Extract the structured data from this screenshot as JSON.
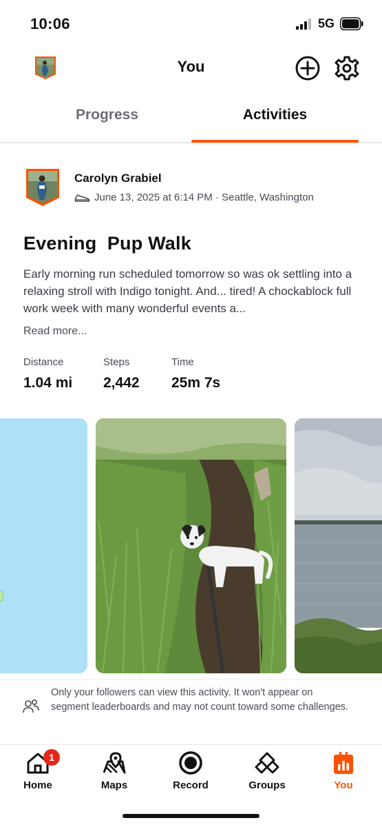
{
  "status_bar": {
    "time": "10:06",
    "network": "5G"
  },
  "header": {
    "title": "You"
  },
  "tabs": [
    {
      "label": "Progress",
      "active": false
    },
    {
      "label": "Activities",
      "active": true
    }
  ],
  "activity": {
    "athlete_name": "Carolyn Grabiel",
    "meta": "June 13, 2025 at 6:14 PM · Seattle, Washington",
    "title": "Evening  Pup Walk",
    "description": "Early morning run scheduled tomorrow so was ok settling into a relaxing stroll with Indigo tonight. And... tired! A chockablock full work week with many wonderful events a...",
    "read_more": "Read more...",
    "stats": [
      {
        "label": "Distance",
        "value": "1.04 mi"
      },
      {
        "label": "Steps",
        "value": "2,442"
      },
      {
        "label": "Time",
        "value": "25m 7s"
      }
    ]
  },
  "privacy_notice": "Only your followers can view this activity. It won't appear on segment leaderboards and may not count toward some challenges.",
  "bottom_nav": {
    "items": [
      {
        "label": "Home",
        "icon": "home-icon",
        "badge": "1"
      },
      {
        "label": "Maps",
        "icon": "map-icon"
      },
      {
        "label": "Record",
        "icon": "record-icon"
      },
      {
        "label": "Groups",
        "icon": "groups-icon"
      },
      {
        "label": "You",
        "icon": "you-icon",
        "active": true
      }
    ]
  },
  "colors": {
    "accent": "#fc5200",
    "badge": "#e3281b",
    "map_water": "#aee0f7"
  }
}
